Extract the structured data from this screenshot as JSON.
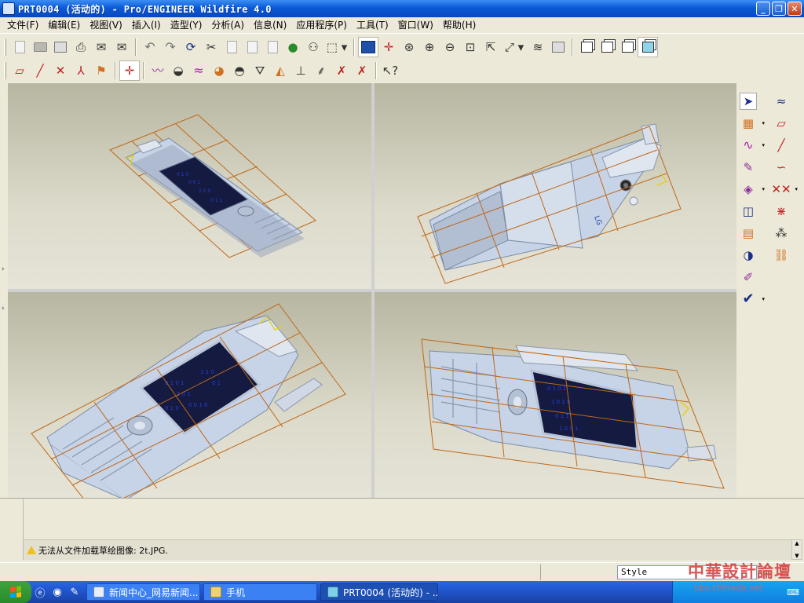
{
  "window": {
    "title": "PRT0004 (活动的) - Pro/ENGINEER Wildfire 4.0",
    "controls": [
      "minimize",
      "maximize",
      "close"
    ]
  },
  "menubar": [
    "文件(F)",
    "编辑(E)",
    "视图(V)",
    "插入(I)",
    "造型(Y)",
    "分析(A)",
    "信息(N)",
    "应用程序(P)",
    "工具(T)",
    "窗口(W)",
    "帮助(H)"
  ],
  "toolbar_top": [
    "new-icon",
    "open-icon",
    "save-icon",
    "print-icon",
    "email-icon",
    "email-attach-icon",
    "undo-icon",
    "redo-icon",
    "regenerate-icon",
    "cut-icon",
    "copy-icon",
    "paste-icon",
    "paste-special-icon",
    "traffic-light-icon",
    "find-icon",
    "select-box-icon",
    "repaint-icon",
    "spin-center-icon",
    "orient-icon",
    "zoom-in-icon",
    "zoom-out-icon",
    "refit-icon",
    "orient-view-icon",
    "saved-views-icon",
    "layers-icon",
    "view-manager-icon",
    "wireframe-icon",
    "hidden-line-icon",
    "no-hidden-icon",
    "shaded-icon"
  ],
  "toolbar_second": [
    "datum-planes-icon",
    "datum-axes-icon",
    "datum-points-icon",
    "coordinate-systems-icon",
    "annotations-icon",
    "spin-center-toggle-icon",
    "curve-analysis-icon",
    "section-analysis-icon",
    "offset-analysis-icon",
    "reflection-analysis-icon",
    "shade-curvature-icon",
    "draft-analysis-icon",
    "slope-analysis-icon",
    "dihedral-analysis-icon",
    "saved-analysis-icon",
    "hide-analysis-icon",
    "delete-analysis-icon",
    "context-help-icon"
  ],
  "right_toolbar": [
    "select-arrow-icon",
    "curve-from-cross-section-icon",
    "internal-plane-icon",
    "datum-plane-icon",
    "curve-icon",
    "datum-axis-icon",
    "curve-edit-icon",
    "curve-sketch-icon",
    "surface-icon",
    "datum-point-icon",
    "boundary-surface-icon",
    "offset-point-icon",
    "trim-surface-icon",
    "cos-icon",
    "connect-surface-icon",
    "convert-icon",
    "done-checkmark-icon"
  ],
  "status": {
    "message": "无法从文件加载草绘图像: 2t.JPG.",
    "filter_label": "Style"
  },
  "taskbar": {
    "tasks": [
      {
        "label": "新闻中心_网易新闻...",
        "icon": "browser-icon",
        "active": false
      },
      {
        "label": "手机",
        "icon": "folder-icon",
        "active": false
      },
      {
        "label": "PRT0004 (活动的) - ...",
        "icon": "proe-icon",
        "active": true
      }
    ]
  },
  "watermark": {
    "title": "中華設計論壇",
    "url": "bbs.chinade.net"
  },
  "colors": {
    "titlebar": "#0a5bd6",
    "wireframe": "#c06818",
    "phone_body": "#c7d3e6",
    "screen": "#141a40",
    "keys": "#2a3dd8"
  }
}
